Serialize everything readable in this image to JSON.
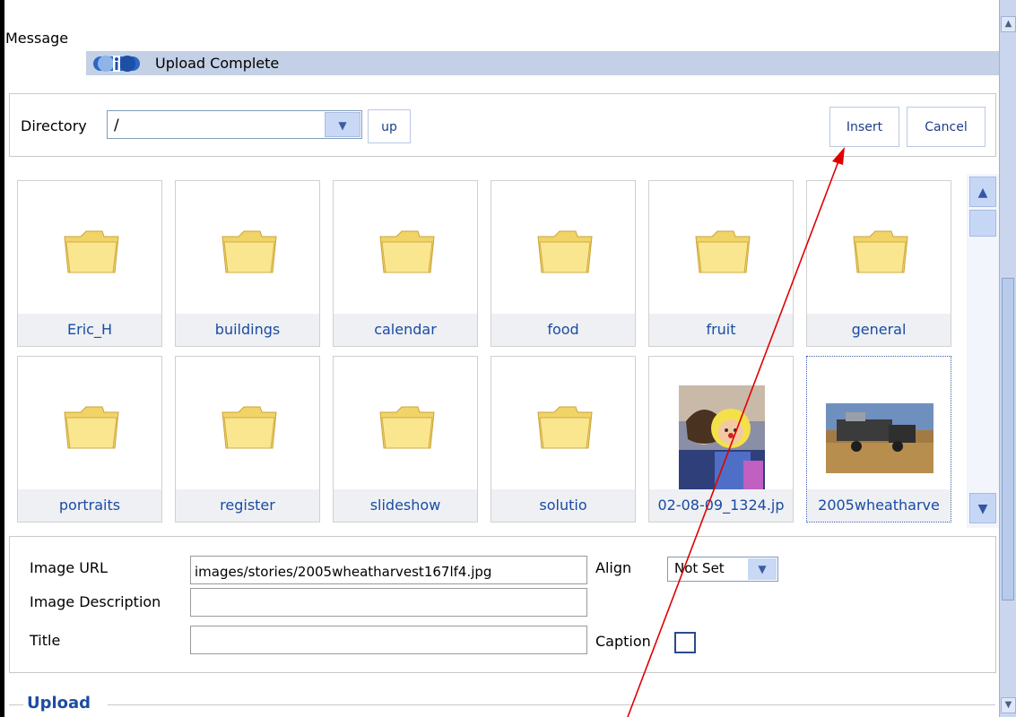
{
  "message": {
    "label": "Message",
    "text": "Upload Complete",
    "icon": "info-icon"
  },
  "directory": {
    "label": "Directory",
    "selected": "/",
    "up_label": "up",
    "insert_label": "Insert",
    "cancel_label": "Cancel"
  },
  "browser": {
    "items": [
      {
        "name": "Eric_H",
        "type": "folder"
      },
      {
        "name": "buildings",
        "type": "folder"
      },
      {
        "name": "calendar",
        "type": "folder"
      },
      {
        "name": "food",
        "type": "folder"
      },
      {
        "name": "fruit",
        "type": "folder"
      },
      {
        "name": "general",
        "type": "folder"
      },
      {
        "name": "portraits",
        "type": "folder"
      },
      {
        "name": "register",
        "type": "folder"
      },
      {
        "name": "slideshow",
        "type": "folder"
      },
      {
        "name": "solutio",
        "type": "folder"
      },
      {
        "name": "02-08-09_1324.jp",
        "type": "image"
      },
      {
        "name": "2005wheatharve",
        "type": "image",
        "selected": true
      }
    ]
  },
  "properties": {
    "image_url_label": "Image URL",
    "image_url_value": "images/stories/2005wheatharvest167lf4.jpg",
    "align_label": "Align",
    "align_value": "Not Set",
    "description_label": "Image Description",
    "description_value": "",
    "title_label": "Title",
    "title_value": "",
    "caption_label": "Caption",
    "caption_checked": false
  },
  "upload": {
    "legend": "Upload"
  },
  "colors": {
    "accent": "#1a4ba3",
    "message_bar": "#c3d0e5",
    "annotation_arrow": "#e00000"
  }
}
